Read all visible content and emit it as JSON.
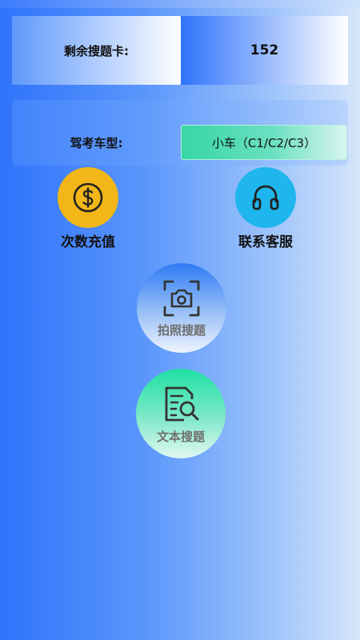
{
  "remaining": {
    "label": "剩余搜题卡:",
    "value": "152"
  },
  "exam": {
    "label": "驾考车型:",
    "selected": "小车（C1/C2/C3）"
  },
  "actions": {
    "recharge": {
      "label": "次数充值",
      "icon": "dollar-icon",
      "color": "#f2b618"
    },
    "service": {
      "label": "联系客服",
      "icon": "headphones-icon",
      "color": "#1eb6ec"
    },
    "photo_search": {
      "label": "拍照搜题",
      "icon": "camera-scan-icon"
    },
    "text_search": {
      "label": "文本搜题",
      "icon": "document-search-icon"
    }
  }
}
